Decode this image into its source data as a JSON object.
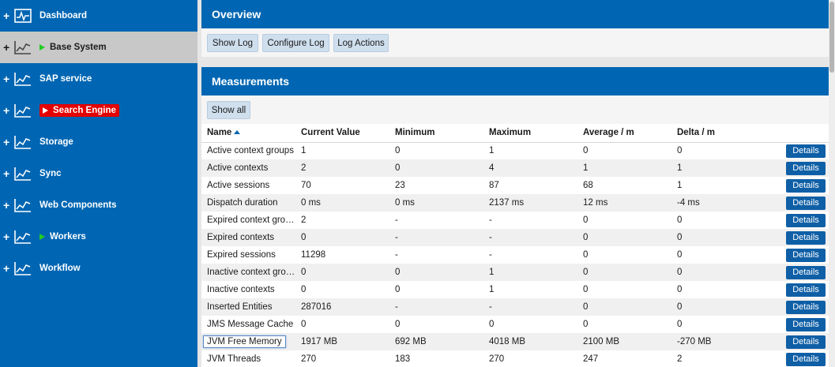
{
  "sidebar": {
    "items": [
      {
        "label": "Dashboard",
        "active": false,
        "status": "none",
        "icon": "dashboard-icon"
      },
      {
        "label": "Base System",
        "active": true,
        "status": "running",
        "icon": "chart-icon"
      },
      {
        "label": "SAP service",
        "active": false,
        "status": "none",
        "icon": "chart-icon"
      },
      {
        "label": "Search Engine",
        "active": false,
        "status": "error",
        "icon": "chart-icon"
      },
      {
        "label": "Storage",
        "active": false,
        "status": "none",
        "icon": "chart-icon"
      },
      {
        "label": "Sync",
        "active": false,
        "status": "none",
        "icon": "chart-icon"
      },
      {
        "label": "Web Components",
        "active": false,
        "status": "none",
        "icon": "chart-icon"
      },
      {
        "label": "Workers",
        "active": false,
        "status": "running",
        "icon": "chart-icon"
      },
      {
        "label": "Workflow",
        "active": false,
        "status": "none",
        "icon": "chart-icon"
      }
    ]
  },
  "overview": {
    "title": "Overview",
    "buttons": {
      "show_log": "Show Log",
      "configure_log": "Configure Log",
      "log_actions": "Log Actions"
    }
  },
  "measurements": {
    "title": "Measurements",
    "show_all": "Show all",
    "columns": {
      "name": "Name",
      "current": "Current Value",
      "minimum": "Minimum",
      "maximum": "Maximum",
      "average": "Average / m",
      "delta": "Delta / m"
    },
    "details_label": "Details",
    "rows": [
      {
        "name": "Active context groups",
        "current": "1",
        "minimum": "0",
        "maximum": "1",
        "average": "0",
        "delta": "0"
      },
      {
        "name": "Active contexts",
        "current": "2",
        "minimum": "0",
        "maximum": "4",
        "average": "1",
        "delta": "1"
      },
      {
        "name": "Active sessions",
        "current": "70",
        "minimum": "23",
        "maximum": "87",
        "average": "68",
        "delta": "1"
      },
      {
        "name": "Dispatch duration",
        "current": "0 ms",
        "minimum": "0 ms",
        "maximum": "2137 ms",
        "average": "12 ms",
        "delta": "-4 ms"
      },
      {
        "name": "Expired context groups",
        "current": "2",
        "minimum": "-",
        "maximum": "-",
        "average": "0",
        "delta": "0"
      },
      {
        "name": "Expired contexts",
        "current": "0",
        "minimum": "-",
        "maximum": "-",
        "average": "0",
        "delta": "0"
      },
      {
        "name": "Expired sessions",
        "current": "11298",
        "minimum": "-",
        "maximum": "-",
        "average": "0",
        "delta": "0"
      },
      {
        "name": "Inactive context groups",
        "current": "0",
        "minimum": "0",
        "maximum": "1",
        "average": "0",
        "delta": "0"
      },
      {
        "name": "Inactive contexts",
        "current": "0",
        "minimum": "0",
        "maximum": "1",
        "average": "0",
        "delta": "0"
      },
      {
        "name": "Inserted Entities",
        "current": "287016",
        "minimum": "-",
        "maximum": "-",
        "average": "0",
        "delta": "0"
      },
      {
        "name": "JMS Message Cache",
        "current": "0",
        "minimum": "0",
        "maximum": "0",
        "average": "0",
        "delta": "0"
      },
      {
        "name": "JVM Free Memory",
        "current": "1917 MB",
        "minimum": "692 MB",
        "maximum": "4018 MB",
        "average": "2100 MB",
        "delta": "-270 MB"
      },
      {
        "name": "JVM Threads",
        "current": "270",
        "minimum": "183",
        "maximum": "270",
        "average": "247",
        "delta": "2"
      }
    ]
  },
  "colors": {
    "brand_blue": "#0066b3",
    "active_gray": "#c8c8c8",
    "running_green": "#22cc22",
    "error_red": "#e30000"
  }
}
